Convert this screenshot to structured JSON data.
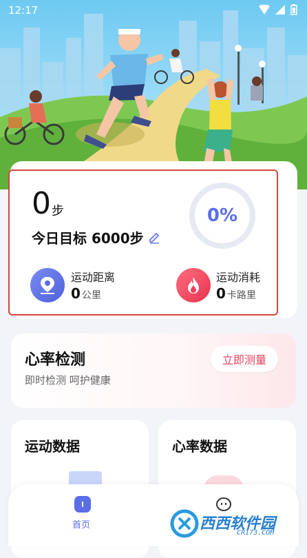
{
  "status_bar": {
    "time": "12:17"
  },
  "steps": {
    "value": "0",
    "unit": "步",
    "goal_label": "今日目标 6000步",
    "percent_text": "0%",
    "percent": 0
  },
  "stats": {
    "distance": {
      "label": "运动距离",
      "value": "0",
      "unit": "公里"
    },
    "calories": {
      "label": "运动消耗",
      "value": "0",
      "unit": "卡路里"
    }
  },
  "heart_rate_card": {
    "title": "心率检测",
    "subtitle": "即时检测 呵护健康",
    "button": "立即测量"
  },
  "tiles": {
    "sport_data": "运动数据",
    "heart_data": "心率数据"
  },
  "nav": {
    "home": "首页"
  },
  "watermark": {
    "text": "西西软件园",
    "domain": "CR173.COM"
  },
  "colors": {
    "accent": "#5b6ee8",
    "fire": "#f0405a",
    "frame": "#d3453b"
  }
}
